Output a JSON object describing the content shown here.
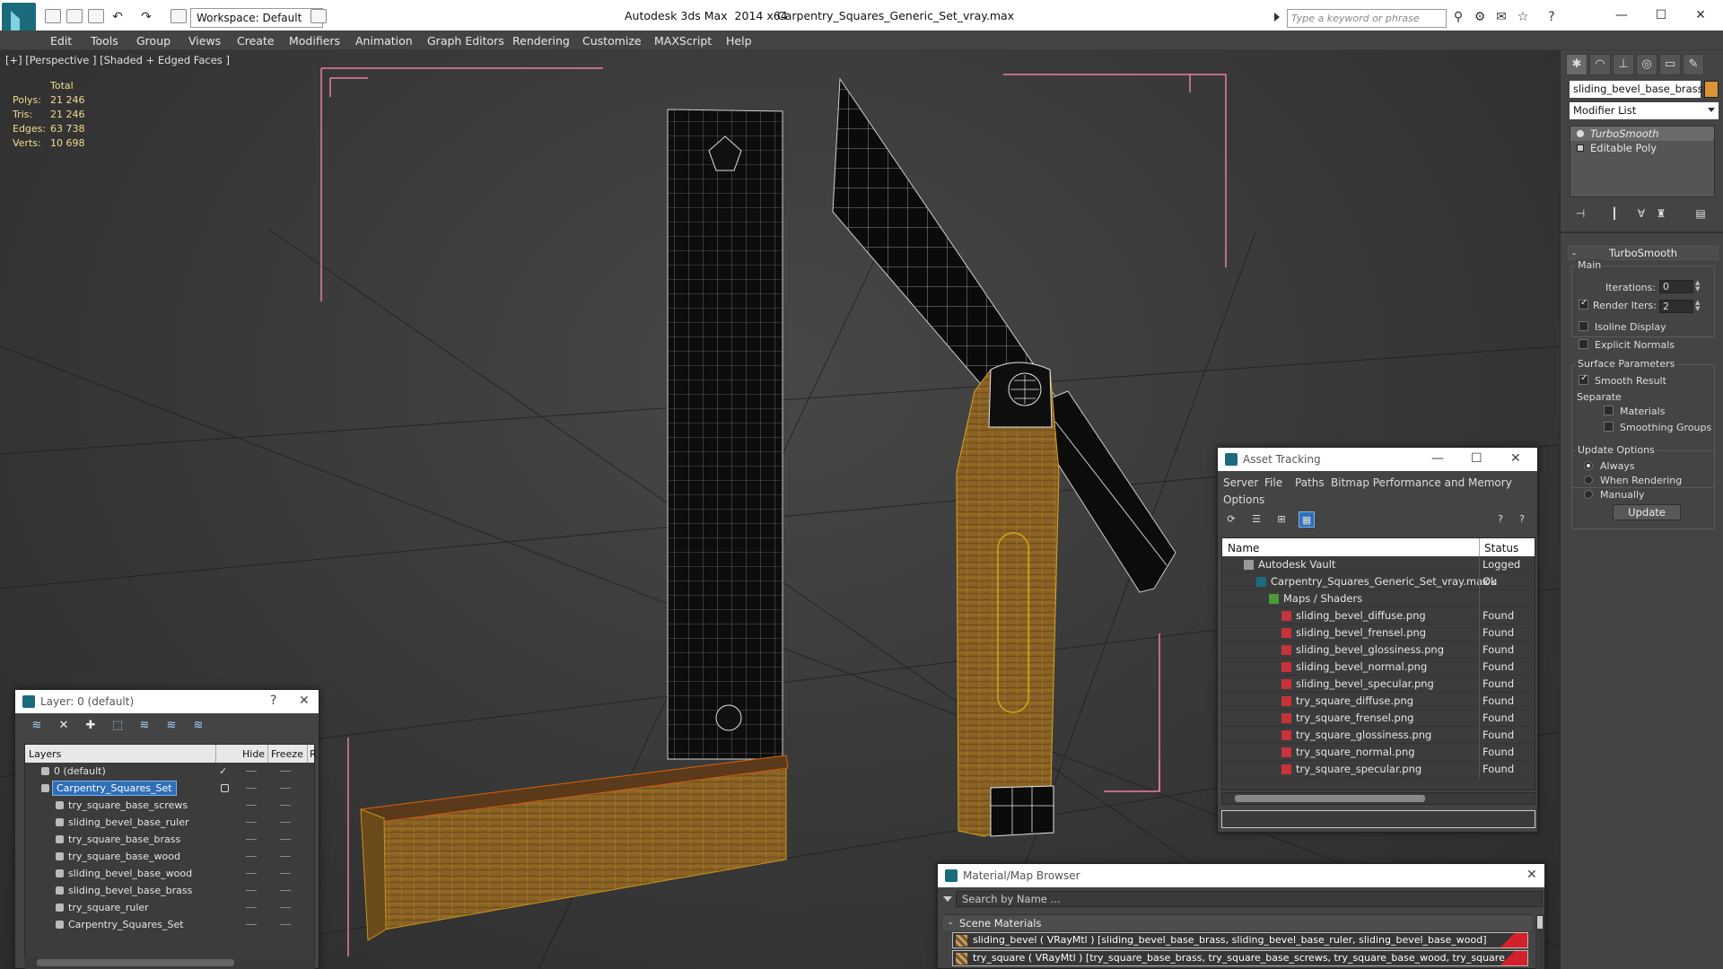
{
  "titlebar": {
    "app_title": "Autodesk 3ds Max  2014 x64",
    "doc_title": "Carpentry_Squares_Generic_Set_vray.max",
    "workspace": "Workspace: Default",
    "search_placeholder": "Type a keyword or phrase"
  },
  "menu": [
    "Edit",
    "Tools",
    "Group",
    "Views",
    "Create",
    "Modifiers",
    "Animation",
    "Graph Editors",
    "Rendering",
    "Customize",
    "MAXScript",
    "Help"
  ],
  "viewport": {
    "label": "[+] [Perspective ] [Shaded + Edged Faces ]",
    "stats_header": "Total",
    "stats": [
      {
        "key": "Polys:",
        "value": "21 246"
      },
      {
        "key": "Tris:",
        "value": "21 246"
      },
      {
        "key": "Edges:",
        "value": "63 738"
      },
      {
        "key": "Verts:",
        "value": "10 698"
      }
    ]
  },
  "command_panel": {
    "object_name": "sliding_bevel_base_brass",
    "object_color": "#d99436",
    "modifier_list": "Modifier List",
    "stack": [
      {
        "label": "TurboSmooth",
        "selected": true
      },
      {
        "label": "Editable Poly",
        "selected": false
      }
    ],
    "rollout_title": "TurboSmooth",
    "main_group": "Main",
    "iterations_label": "Iterations:",
    "iterations_value": "0",
    "render_iters_label": "Render Iters:",
    "render_iters_value": "2",
    "render_iters_checked": true,
    "isoline_label": "Isoline Display",
    "explicit_normals_label": "Explicit Normals",
    "surface_group": "Surface Parameters",
    "smooth_result_label": "Smooth Result",
    "separate_label": "Separate",
    "materials_label": "Materials",
    "smoothing_groups_label": "Smoothing Groups",
    "update_group": "Update Options",
    "update_always": "Always",
    "update_when_rendering": "When Rendering",
    "update_manually": "Manually",
    "update_button": "Update"
  },
  "layer_window": {
    "title": "Layer: 0 (default)",
    "help": "?",
    "columns": [
      "Layers",
      "Hide",
      "Freeze",
      "R"
    ],
    "rows": [
      {
        "name": "0 (default)",
        "level": 0,
        "selected": false,
        "active": true
      },
      {
        "name": "Carpentry_Squares_Set",
        "level": 0,
        "selected": true,
        "active": false
      },
      {
        "name": "try_square_base_screws",
        "level": 1,
        "selected": false,
        "active": false
      },
      {
        "name": "sliding_bevel_base_ruler",
        "level": 1,
        "selected": false,
        "active": false
      },
      {
        "name": "try_square_base_brass",
        "level": 1,
        "selected": false,
        "active": false
      },
      {
        "name": "try_square_base_wood",
        "level": 1,
        "selected": false,
        "active": false
      },
      {
        "name": "sliding_bevel_base_wood",
        "level": 1,
        "selected": false,
        "active": false
      },
      {
        "name": "sliding_bevel_base_brass",
        "level": 1,
        "selected": false,
        "active": false
      },
      {
        "name": "try_square_ruler",
        "level": 1,
        "selected": false,
        "active": false
      },
      {
        "name": "Carpentry_Squares_Set",
        "level": 1,
        "selected": false,
        "active": false
      }
    ]
  },
  "asset_window": {
    "title": "Asset Tracking",
    "menu": [
      "Server",
      "File",
      "Paths",
      "Bitmap Performance and Memory",
      "Options"
    ],
    "columns": [
      "Name",
      "Status"
    ],
    "rows": [
      {
        "name": "Autodesk Vault",
        "status": "Logged Ou",
        "level": 1,
        "icon": "vault"
      },
      {
        "name": "Carpentry_Squares_Generic_Set_vray.max",
        "status": "Ok",
        "level": 2,
        "icon": "max"
      },
      {
        "name": "Maps / Shaders",
        "status": "",
        "level": 3,
        "icon": "maps"
      },
      {
        "name": "sliding_bevel_diffuse.png",
        "status": "Found",
        "level": 4,
        "icon": "png"
      },
      {
        "name": "sliding_bevel_frensel.png",
        "status": "Found",
        "level": 4,
        "icon": "png"
      },
      {
        "name": "sliding_bevel_glossiness.png",
        "status": "Found",
        "level": 4,
        "icon": "png"
      },
      {
        "name": "sliding_bevel_normal.png",
        "status": "Found",
        "level": 4,
        "icon": "png"
      },
      {
        "name": "sliding_bevel_specular.png",
        "status": "Found",
        "level": 4,
        "icon": "png"
      },
      {
        "name": "try_square_diffuse.png",
        "status": "Found",
        "level": 4,
        "icon": "png"
      },
      {
        "name": "try_square_frensel.png",
        "status": "Found",
        "level": 4,
        "icon": "png"
      },
      {
        "name": "try_square_glossiness.png",
        "status": "Found",
        "level": 4,
        "icon": "png"
      },
      {
        "name": "try_square_normal.png",
        "status": "Found",
        "level": 4,
        "icon": "png"
      },
      {
        "name": "try_square_specular.png",
        "status": "Found",
        "level": 4,
        "icon": "png"
      }
    ]
  },
  "material_window": {
    "title": "Material/Map Browser",
    "search_placeholder": "Search by Name ...",
    "section": "Scene Materials",
    "rows": [
      "sliding_bevel ( VRayMtl ) [sliding_bevel_base_brass, sliding_bevel_base_ruler, sliding_bevel_base_wood]",
      "try_square ( VRayMtl ) [try_square_base_brass, try_square_base_screws, try_square_base_wood, try_square_ruler]"
    ]
  }
}
